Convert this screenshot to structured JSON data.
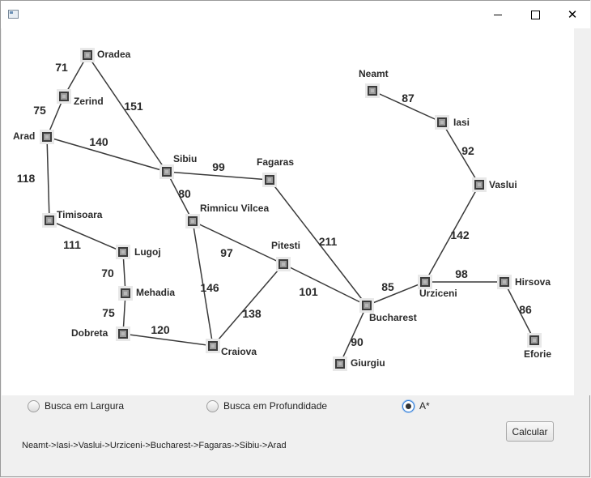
{
  "window": {
    "title": "",
    "icon": "app-window-icon",
    "controls": [
      "minimize-icon",
      "maximize-icon",
      "close-icon"
    ],
    "close_glyph": "✕"
  },
  "graph": {
    "cities": [
      "Oradea",
      "Zerind",
      "Arad",
      "Timisoara",
      "Lugoj",
      "Mehadia",
      "Dobreta",
      "Sibiu",
      "Rimnicu Vilcea",
      "Fagaras",
      "Pitesti",
      "Craiova",
      "Bucharest",
      "Giurgiu",
      "Urziceni",
      "Hirsova",
      "Eforie",
      "Vaslui",
      "Iasi",
      "Neamt"
    ],
    "roads": [
      {
        "from": "Oradea",
        "to": "Zerind",
        "distance": "71"
      },
      {
        "from": "Zerind",
        "to": "Arad",
        "distance": "75"
      },
      {
        "from": "Oradea",
        "to": "Sibiu",
        "distance": "151"
      },
      {
        "from": "Arad",
        "to": "Sibiu",
        "distance": "140"
      },
      {
        "from": "Arad",
        "to": "Timisoara",
        "distance": "118"
      },
      {
        "from": "Timisoara",
        "to": "Lugoj",
        "distance": "111"
      },
      {
        "from": "Lugoj",
        "to": "Mehadia",
        "distance": "70"
      },
      {
        "from": "Mehadia",
        "to": "Dobreta",
        "distance": "75"
      },
      {
        "from": "Dobreta",
        "to": "Craiova",
        "distance": "120"
      },
      {
        "from": "Sibiu",
        "to": "Fagaras",
        "distance": "99"
      },
      {
        "from": "Sibiu",
        "to": "Rimnicu Vilcea",
        "distance": "80"
      },
      {
        "from": "Rimnicu Vilcea",
        "to": "Pitesti",
        "distance": "97"
      },
      {
        "from": "Rimnicu Vilcea",
        "to": "Craiova",
        "distance": "146"
      },
      {
        "from": "Craiova",
        "to": "Pitesti",
        "distance": "138"
      },
      {
        "from": "Pitesti",
        "to": "Bucharest",
        "distance": "101"
      },
      {
        "from": "Fagaras",
        "to": "Bucharest",
        "distance": "211"
      },
      {
        "from": "Bucharest",
        "to": "Giurgiu",
        "distance": "90"
      },
      {
        "from": "Bucharest",
        "to": "Urziceni",
        "distance": "85"
      },
      {
        "from": "Urziceni",
        "to": "Hirsova",
        "distance": "98"
      },
      {
        "from": "Hirsova",
        "to": "Eforie",
        "distance": "86"
      },
      {
        "from": "Urziceni",
        "to": "Vaslui",
        "distance": "142"
      },
      {
        "from": "Vaslui",
        "to": "Iasi",
        "distance": "92"
      },
      {
        "from": "Iasi",
        "to": "Neamt",
        "distance": "87"
      }
    ]
  },
  "options": {
    "bfs_label": "Busca em Largura",
    "dfs_label": "Busca em Profundidade",
    "astar_label": "A*",
    "selected": "A*"
  },
  "calculate_label": "Calcular",
  "result_path": "Neamt->Iasi->Vaslui->Urziceni->Bucharest->Fagaras->Sibiu->Arad"
}
